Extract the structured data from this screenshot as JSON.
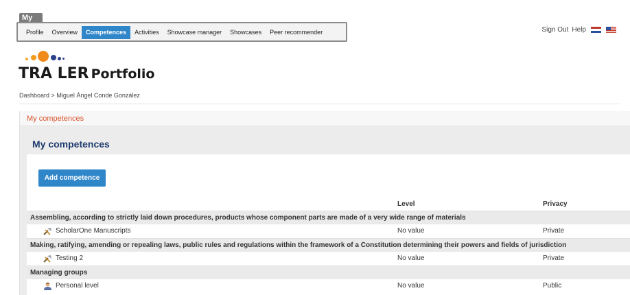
{
  "nav": {
    "my_tab": "My",
    "items": [
      {
        "label": "Profile",
        "active": false
      },
      {
        "label": "Overview",
        "active": false
      },
      {
        "label": "Competences",
        "active": true
      },
      {
        "label": "Activities",
        "active": false
      },
      {
        "label": "Showcase manager",
        "active": false
      },
      {
        "label": "Showcases",
        "active": false
      },
      {
        "label": "Peer recommender",
        "active": false
      }
    ],
    "sign_out": "Sign Out",
    "help": "Help"
  },
  "logo": {
    "brand": "TRA LER",
    "product": "Portfolio"
  },
  "breadcrumb": {
    "root": "Dashboard",
    "separator": ">",
    "current": "Miguel Ángel Conde González"
  },
  "panel": {
    "header": "My competences",
    "title": "My competences",
    "add_button": "Add competence",
    "columns": {
      "level": "Level",
      "privacy": "Privacy"
    }
  },
  "groups": [
    {
      "label": "Assembling, according to strictly laid down procedures, products whose component parts are made of a very wide range of materials",
      "items": [
        {
          "name": "ScholarOne Manuscripts",
          "level": "No value",
          "privacy": "Private",
          "icon": "tools-icon"
        }
      ]
    },
    {
      "label": "Making, ratifying, amending or repealing laws, public rules and regulations within the framework of a Constitution determining their powers and fields of jurisdiction",
      "items": [
        {
          "name": "Testing 2",
          "level": "No value",
          "privacy": "Private",
          "icon": "tools-icon"
        }
      ]
    },
    {
      "label": "Managing groups",
      "items": [
        {
          "name": "Personal level",
          "level": "No value",
          "privacy": "Public",
          "icon": "person-icon"
        }
      ]
    }
  ],
  "colors": {
    "accent_blue": "#2f86c9",
    "title_navy": "#1f3c6e",
    "header_orange": "#d9532c"
  }
}
